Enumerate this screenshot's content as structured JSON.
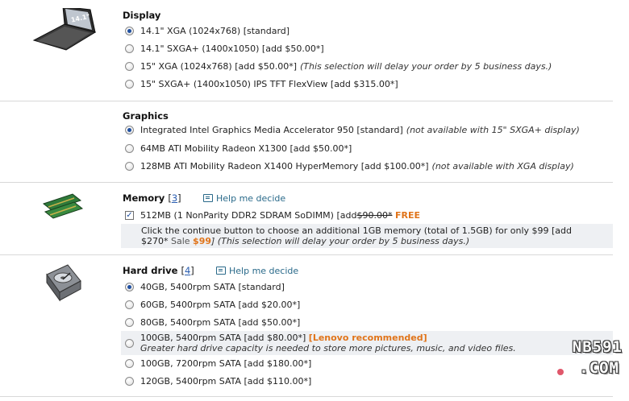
{
  "display": {
    "title": "Display",
    "image_label": "14.1\" or 15\"",
    "options": [
      {
        "label": "14.1\" XGA (1024x768) [standard]",
        "note": "",
        "selected": true
      },
      {
        "label": "14.1\" SXGA+ (1400x1050) [add $50.00*]",
        "note": "",
        "selected": false
      },
      {
        "label": "15\" XGA (1024x768) [add $50.00*]",
        "note": "(This selection will delay your order by 5 business days.)",
        "selected": false
      },
      {
        "label": "15\" SXGA+ (1400x1050) IPS TFT FlexView [add $315.00*]",
        "note": "",
        "selected": false
      }
    ]
  },
  "graphics": {
    "title": "Graphics",
    "options": [
      {
        "label": "Integrated Intel Graphics Media Accelerator 950 [standard]",
        "note": "(not available with 15\" SXGA+ display)",
        "selected": true
      },
      {
        "label": "64MB ATI Mobility Radeon X1300 [add $50.00*]",
        "note": "",
        "selected": false
      },
      {
        "label": "128MB ATI Mobility Radeon X1400 HyperMemory [add $100.00*]",
        "note": "(not available with XGA display)",
        "selected": false
      }
    ]
  },
  "memory": {
    "title": "Memory",
    "ref_open": "[",
    "ref": "3",
    "ref_close": "]",
    "help": "Help me decide",
    "option": {
      "prefix": "512MB (1 NonParity DDR2 SDRAM SoDIMM) [add ",
      "old_price": "$90.00*",
      "free": "FREE",
      "checked": true
    },
    "info_line1": "Click the continue button to choose an additional 1GB memory (total of 1.5GB) for only $99 [add",
    "info_line2_prefix": "$270*",
    "sale_label": "Sale",
    "sale_price": "$99",
    "info_line2_suffix": "] (This selection will delay your order by 5 business days.)"
  },
  "hard_drive": {
    "title": "Hard drive",
    "ref_open": "[",
    "ref": "4",
    "ref_close": "]",
    "help": "Help me decide",
    "options": [
      {
        "label": "40GB, 5400rpm SATA [standard]",
        "selected": true
      },
      {
        "label": "60GB, 5400rpm SATA [add $20.00*]",
        "selected": false
      },
      {
        "label": "80GB, 5400rpm SATA [add $50.00*]",
        "selected": false
      },
      {
        "label": "100GB, 5400rpm SATA [add $80.00*]",
        "selected": false
      },
      {
        "label": "100GB, 7200rpm SATA [add $180.00*]",
        "selected": false
      },
      {
        "label": "120GB, 5400rpm SATA [add $110.00*]",
        "selected": false
      }
    ],
    "recommended": "[Lenovo recommended]",
    "recommended_note": "Greater hard drive capacity is needed to store more pictures, music, and video files."
  },
  "watermark": {
    "line1": "NB591",
    "line2": ".COM"
  }
}
